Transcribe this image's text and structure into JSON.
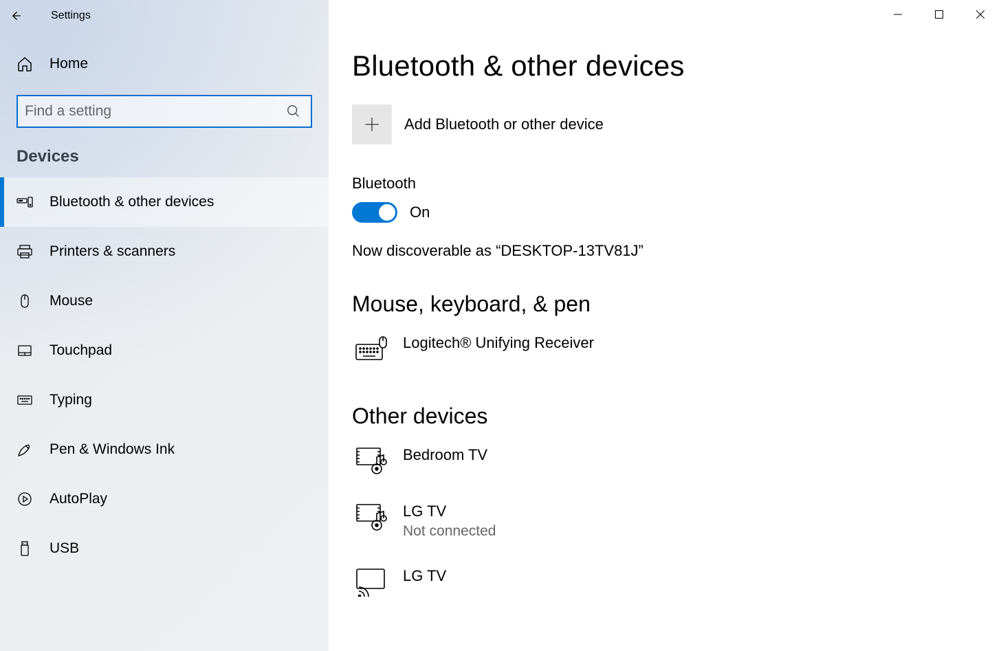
{
  "window": {
    "title": "Settings"
  },
  "sidebar": {
    "home_label": "Home",
    "search_placeholder": "Find a setting",
    "section_label": "Devices",
    "items": [
      {
        "label": "Bluetooth & other devices",
        "active": true
      },
      {
        "label": "Printers & scanners"
      },
      {
        "label": "Mouse"
      },
      {
        "label": "Touchpad"
      },
      {
        "label": "Typing"
      },
      {
        "label": "Pen & Windows Ink"
      },
      {
        "label": "AutoPlay"
      },
      {
        "label": "USB"
      }
    ]
  },
  "main": {
    "page_title": "Bluetooth & other devices",
    "add_device_label": "Add Bluetooth or other device",
    "bluetooth": {
      "label": "Bluetooth",
      "state_label": "On",
      "discoverable_text": "Now discoverable as “DESKTOP-13TV81J”"
    },
    "sections": {
      "mouse_keyboard": {
        "heading": "Mouse, keyboard, & pen",
        "devices": [
          {
            "name": "Logitech® Unifying Receiver"
          }
        ]
      },
      "other": {
        "heading": "Other devices",
        "devices": [
          {
            "name": "Bedroom TV"
          },
          {
            "name": "LG TV",
            "status": "Not connected"
          },
          {
            "name": "LG TV"
          }
        ]
      }
    }
  }
}
